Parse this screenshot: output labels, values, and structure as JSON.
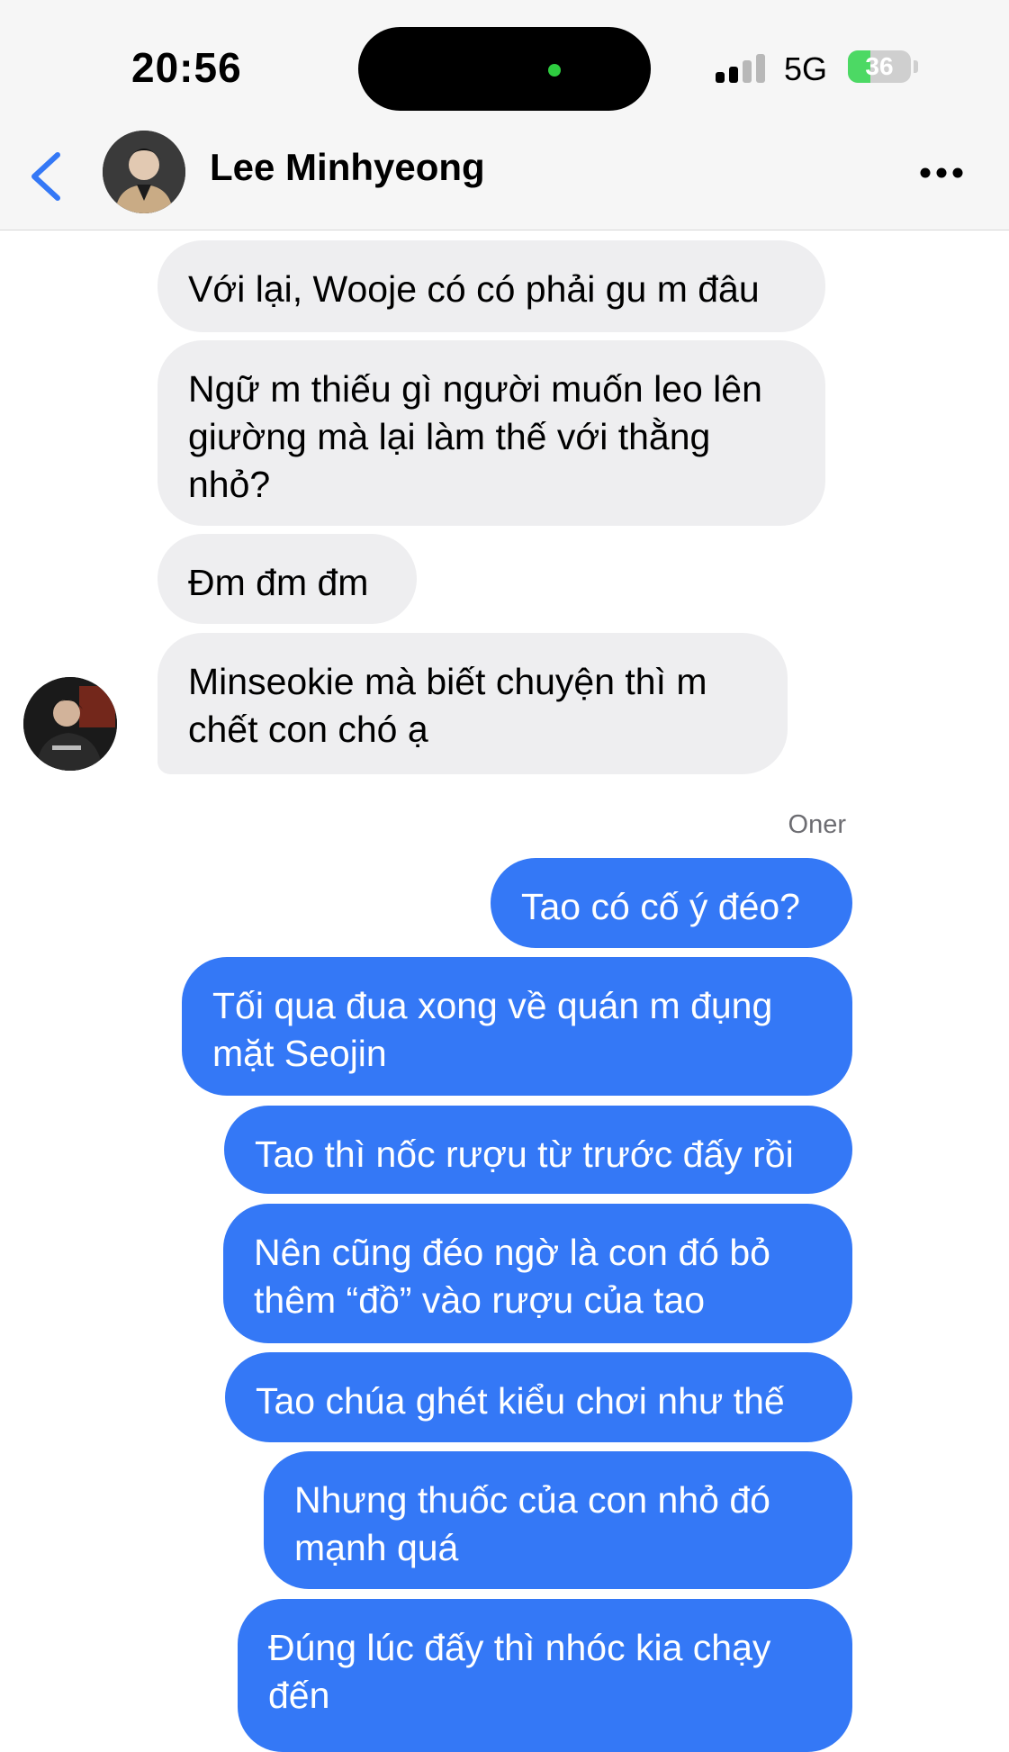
{
  "status_bar": {
    "time": "20:56",
    "network": "5G",
    "battery": "36",
    "battery_level_percent": 36,
    "signal_bars_active": 2,
    "signal_bars_total": 4
  },
  "header": {
    "contact_name": "Lee Minhyeong",
    "back_icon": "chevron-left-icon",
    "more_icon": "ellipsis-icon"
  },
  "colors": {
    "incoming_bubble": "#eeeef0",
    "outgoing_bubble": "#3478f6",
    "accent": "#3478f6",
    "battery_green": "#4cd964"
  },
  "incoming_messages": [
    "Với lại, Wooje có có phải gu m đâu",
    "Ngữ m thiếu gì người muốn leo lên giường mà lại làm thế với thằng nhỏ?",
    "Đm đm đm",
    "Minseokie mà biết chuyện thì m chết con chó ạ"
  ],
  "sender_name": "Oner",
  "outgoing_messages": [
    "Tao có cố ý đéo?",
    "Tối qua đua xong về quán m đụng mặt Seojin",
    "Tao thì nốc rượu từ trước đấy rồi",
    "Nên cũng đéo ngờ là con đó bỏ thêm “đồ” vào rượu của tao",
    "Tao chúa ghét kiểu chơi như thế",
    "Nhưng thuốc của con nhỏ đó mạnh quá",
    "Đúng lúc đấy thì nhóc kia chạy đến"
  ]
}
